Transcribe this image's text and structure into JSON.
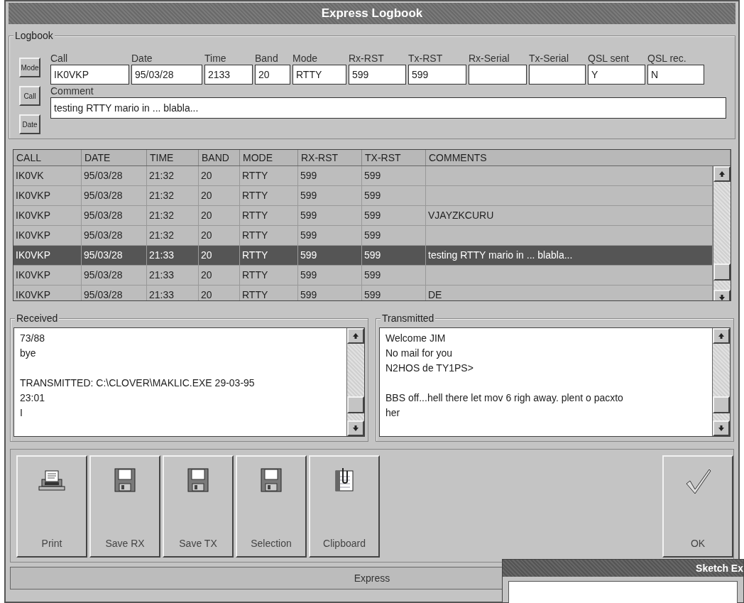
{
  "window": {
    "title": "Express Logbook"
  },
  "logbook": {
    "title": "Logbook",
    "sort_buttons": [
      "Mode",
      "Call",
      "Date"
    ],
    "fields": [
      {
        "label": "Call",
        "value": "IK0VKP"
      },
      {
        "label": "Date",
        "value": "95/03/28"
      },
      {
        "label": "Time",
        "value": "2133"
      },
      {
        "label": "Band",
        "value": "20"
      },
      {
        "label": "Mode",
        "value": "RTTY"
      },
      {
        "label": "Rx-RST",
        "value": "599"
      },
      {
        "label": "Tx-RST",
        "value": "599"
      },
      {
        "label": "Rx-Serial"
      },
      {
        "label": "Tx-Serial"
      },
      {
        "label": "QSL sent",
        "value": "Y"
      },
      {
        "label": "QSL rec.",
        "value": "N"
      }
    ],
    "comment": {
      "label": "Comment",
      "value": "testing RTTY  mario in ... blabla..."
    }
  },
  "table": {
    "columns": [
      "CALL",
      "DATE",
      "TIME",
      "BAND",
      "MODE",
      "RX-RST",
      "TX-RST",
      "COMMENTS"
    ],
    "rows": [
      {
        "cells": [
          "IK0VK",
          "95/03/28",
          "21:32",
          "20",
          "RTTY",
          "599",
          "599",
          ""
        ],
        "selected": false
      },
      {
        "cells": [
          "IK0VKP",
          "95/03/28",
          "21:32",
          "20",
          "RTTY",
          "599",
          "599",
          ""
        ],
        "selected": false
      },
      {
        "cells": [
          "IK0VKP",
          "95/03/28",
          "21:32",
          "20",
          "RTTY",
          "599",
          "599",
          "VJAYZKCURU"
        ],
        "selected": false
      },
      {
        "cells": [
          "IK0VKP",
          "95/03/28",
          "21:32",
          "20",
          "RTTY",
          "599",
          "599",
          ""
        ],
        "selected": false
      },
      {
        "cells": [
          "IK0VKP",
          "95/03/28",
          "21:33",
          "20",
          "RTTY",
          "599",
          "599",
          "testing RTTY  mario in ... blabla..."
        ],
        "selected": true
      },
      {
        "cells": [
          "IK0VKP",
          "95/03/28",
          "21:33",
          "20",
          "RTTY",
          "599",
          "599",
          ""
        ],
        "selected": false
      },
      {
        "cells": [
          "IK0VKP",
          "95/03/28",
          "21:33",
          "20",
          "RTTY",
          "599",
          "599",
          "DE"
        ],
        "selected": false
      }
    ]
  },
  "received": {
    "title": "Received",
    "paragraphs": [
      [
        "73/88",
        "bye"
      ],
      [
        "TRANSMITTED: C:\\CLOVER\\MAKLIC.EXE  29-03-95",
        "23:01",
        "I"
      ]
    ]
  },
  "transmitted": {
    "title": "Transmitted",
    "paragraphs": [
      [
        "Welcome JIM",
        "No mail for you",
        "N2HOS de TY1PS>"
      ],
      [
        "BBS off...hell there let mov 6 righ away. plent o pacxto",
        "her"
      ]
    ]
  },
  "toolbar": [
    {
      "kind": "print",
      "label": "Print"
    },
    {
      "kind": "save",
      "label": "Save RX"
    },
    {
      "kind": "save",
      "label": "Save TX"
    },
    {
      "kind": "save",
      "label": "Selection"
    },
    {
      "kind": "clipboard",
      "label": "Clipboard"
    }
  ],
  "ok_button": {
    "label": "OK"
  },
  "status_bar": "Express",
  "overlapping_window": {
    "title": "Sketch Ex"
  }
}
